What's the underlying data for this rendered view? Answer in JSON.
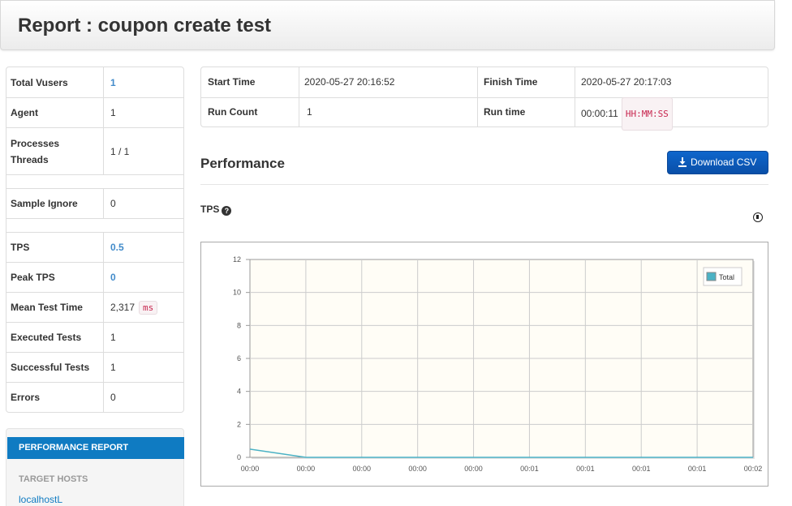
{
  "header": {
    "title": "Report : coupon create test"
  },
  "stats": {
    "total_vusers": {
      "label": "Total Vusers",
      "value": "1"
    },
    "agent": {
      "label": "Agent",
      "value": "1"
    },
    "processes_threads": {
      "label1": "Processes",
      "label2": "Threads",
      "value": "1 / 1"
    },
    "sample_ignore": {
      "label": "Sample Ignore",
      "value": "0"
    },
    "tps": {
      "label": "TPS",
      "value": "0.5"
    },
    "peak_tps": {
      "label": "Peak TPS",
      "value": "0"
    },
    "mean_test_time": {
      "label": "Mean Test Time",
      "value": "2,317",
      "unit": "ms"
    },
    "executed_tests": {
      "label": "Executed Tests",
      "value": "1"
    },
    "successful_tests": {
      "label": "Successful Tests",
      "value": "1"
    },
    "errors": {
      "label": "Errors",
      "value": "0"
    }
  },
  "nav": {
    "active_item": "PERFORMANCE REPORT",
    "section_header": "TARGET HOSTS",
    "host_link": "localhostL"
  },
  "info": {
    "start_time_label": "Start Time",
    "start_time_value": "2020-05-27 20:16:52",
    "finish_time_label": "Finish Time",
    "finish_time_value": "2020-05-27 20:17:03",
    "run_count_label": "Run Count",
    "run_count_value": "1",
    "run_time_label": "Run time",
    "run_time_value": "00:00:11",
    "run_time_format": "HH:MM:SS"
  },
  "performance": {
    "title": "Performance",
    "download_label": "Download CSV",
    "tps_label": "TPS",
    "help_glyph": "?"
  },
  "chart_data": {
    "type": "line",
    "title": "",
    "xlabel": "",
    "ylabel": "",
    "x": [
      "00:00",
      "00:00",
      "00:00",
      "00:00",
      "00:00",
      "00:01",
      "00:01",
      "00:01",
      "00:01",
      "00:02"
    ],
    "yticks": [
      "0",
      "2",
      "4",
      "6",
      "8",
      "10",
      "12"
    ],
    "ylim": [
      0,
      12
    ],
    "grid": true,
    "legend": "top-right",
    "series": [
      {
        "name": "Total",
        "values": [
          0.5,
          0,
          0,
          0,
          0,
          0,
          0,
          0,
          0,
          0
        ],
        "color": "#4bb2c5"
      }
    ],
    "plot_background": "#fffdf6"
  }
}
